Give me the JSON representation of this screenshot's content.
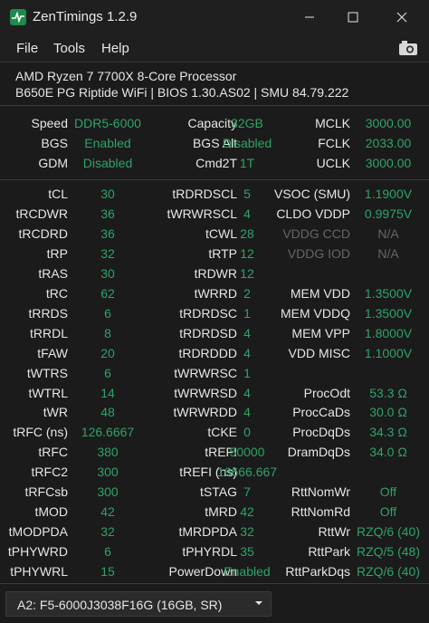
{
  "window": {
    "title": "ZenTimings 1.2.9"
  },
  "menu": {
    "file": "File",
    "tools": "Tools",
    "help": "Help"
  },
  "cpu": {
    "name": "AMD Ryzen 7 7700X 8-Core Processor",
    "board": "B650E PG Riptide WiFi | BIOS 1.30.AS02 | SMU 84.79.222"
  },
  "summary": [
    {
      "l1": "Speed",
      "v1": "DDR5-6000",
      "l2": "Capacity",
      "v2": "32GB",
      "l3": "MCLK",
      "v3": "3000.00"
    },
    {
      "l1": "BGS",
      "v1": "Enabled",
      "l2": "BGS Alt",
      "v2": "Disabled",
      "l3": "FCLK",
      "v3": "2033.00"
    },
    {
      "l1": "GDM",
      "v1": "Disabled",
      "l2": "Cmd2T",
      "v2": "1T",
      "l3": "UCLK",
      "v3": "3000.00"
    }
  ],
  "timings": [
    {
      "l1": "tCL",
      "v1": "30",
      "l2": "tRDRDSCL",
      "v2": "5",
      "l3": "VSOC (SMU)",
      "v3": "1.1900V"
    },
    {
      "l1": "tRCDWR",
      "v1": "36",
      "l2": "tWRWRSCL",
      "v2": "4",
      "l3": "CLDO VDDP",
      "v3": "0.9975V"
    },
    {
      "l1": "tRCDRD",
      "v1": "36",
      "l2": "tCWL",
      "v2": "28",
      "l3": "VDDG CCD",
      "v3": "N/A"
    },
    {
      "l1": "tRP",
      "v1": "32",
      "l2": "tRTP",
      "v2": "12",
      "l3": "VDDG IOD",
      "v3": "N/A"
    },
    {
      "l1": "tRAS",
      "v1": "30",
      "l2": "tRDWR",
      "v2": "12",
      "l3": "",
      "v3": ""
    },
    {
      "l1": "tRC",
      "v1": "62",
      "l2": "tWRRD",
      "v2": "2",
      "l3": "MEM VDD",
      "v3": "1.3500V"
    },
    {
      "l1": "tRRDS",
      "v1": "6",
      "l2": "tRDRDSC",
      "v2": "1",
      "l3": "MEM VDDQ",
      "v3": "1.3500V"
    },
    {
      "l1": "tRRDL",
      "v1": "8",
      "l2": "tRDRDSD",
      "v2": "4",
      "l3": "MEM VPP",
      "v3": "1.8000V"
    },
    {
      "l1": "tFAW",
      "v1": "20",
      "l2": "tRDRDDD",
      "v2": "4",
      "l3": "VDD MISC",
      "v3": "1.1000V"
    },
    {
      "l1": "tWTRS",
      "v1": "6",
      "l2": "tWRWRSC",
      "v2": "1",
      "l3": "",
      "v3": ""
    },
    {
      "l1": "tWTRL",
      "v1": "14",
      "l2": "tWRWRSD",
      "v2": "4",
      "l3": "ProcOdt",
      "v3": "53.3 Ω"
    },
    {
      "l1": "tWR",
      "v1": "48",
      "l2": "tWRWRDD",
      "v2": "4",
      "l3": "ProcCaDs",
      "v3": "30.0 Ω"
    },
    {
      "l1": "tRFC (ns)",
      "v1": "126.6667",
      "l2": "tCKE",
      "v2": "0",
      "l3": "ProcDqDs",
      "v3": "34.3 Ω"
    },
    {
      "l1": "tRFC",
      "v1": "380",
      "l2": "tREFI",
      "v2": "50000",
      "l3": "DramDqDs",
      "v3": "34.0 Ω"
    },
    {
      "l1": "tRFC2",
      "v1": "300",
      "l2": "tREFI (ns)",
      "v2": "16666.667",
      "l3": "",
      "v3": ""
    },
    {
      "l1": "tRFCsb",
      "v1": "300",
      "l2": "tSTAG",
      "v2": "7",
      "l3": "RttNomWr",
      "v3": "Off"
    },
    {
      "l1": "tMOD",
      "v1": "42",
      "l2": "tMRD",
      "v2": "42",
      "l3": "RttNomRd",
      "v3": "Off"
    },
    {
      "l1": "tMODPDA",
      "v1": "32",
      "l2": "tMRDPDA",
      "v2": "32",
      "l3": "RttWr",
      "v3": "RZQ/6 (40)"
    },
    {
      "l1": "tPHYWRD",
      "v1": "6",
      "l2": "tPHYRDL",
      "v2": "35",
      "l3": "RttPark",
      "v3": "RZQ/5 (48)"
    },
    {
      "l1": "tPHYWRL",
      "v1": "15",
      "l2": "PowerDown",
      "v2": "Enabled",
      "l3": "RttParkDqs",
      "v3": "RZQ/6 (40)"
    }
  ],
  "dimm_select": {
    "selected": "A2: F5-6000J3038F16G (16GB, SR)"
  },
  "colors": {
    "value": "#2ea36a",
    "disabled": "#666666",
    "background": "#1b1b1b",
    "app_icon": "#1f8a4c"
  }
}
